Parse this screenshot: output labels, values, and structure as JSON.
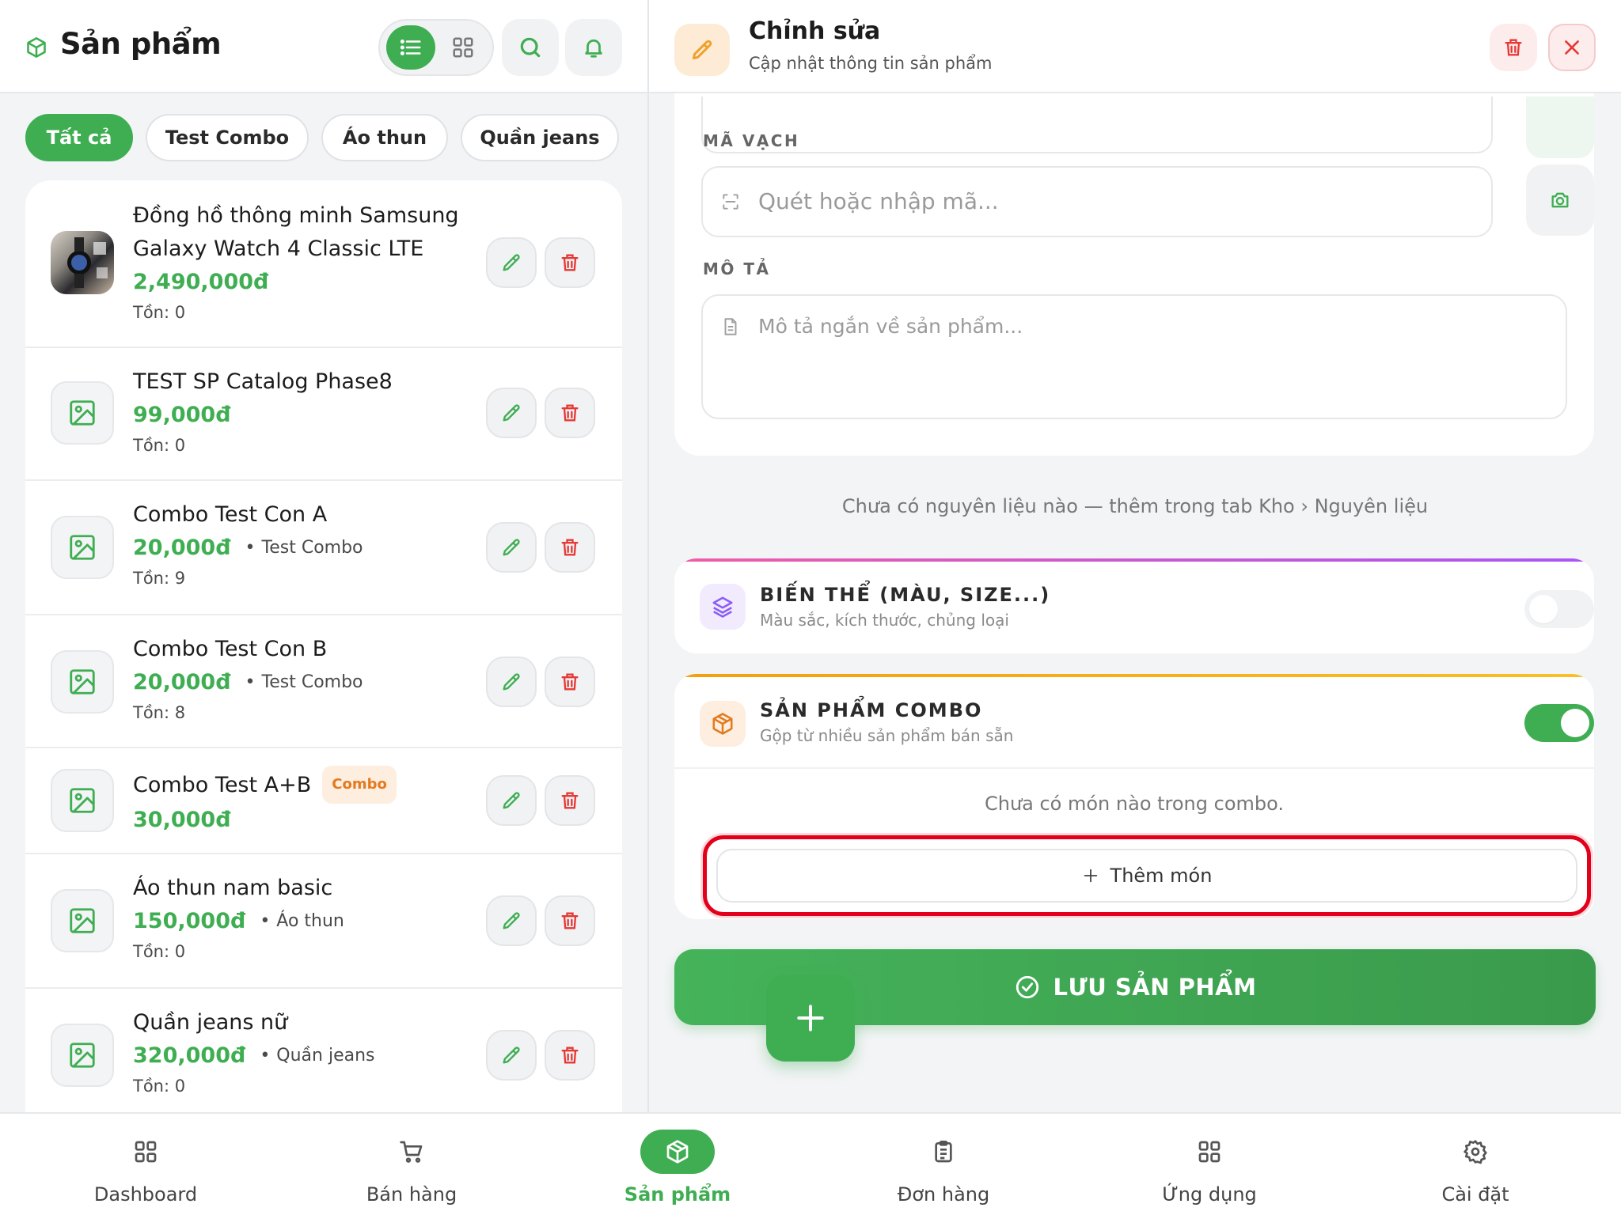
{
  "left_panel": {
    "title": "Sản phẩm",
    "chips": [
      "Tất cả",
      "Test Combo",
      "Áo thun",
      "Quần jeans"
    ],
    "products": [
      {
        "name_line1": "Đồng hồ thông minh Samsung",
        "name_line2": "Galaxy Watch 4 Classic LTE",
        "price": "2,490,000đ",
        "category": "",
        "stock": "Tồn: 0",
        "badge": ""
      },
      {
        "name_line1": "TEST SP Catalog Phase8",
        "name_line2": "",
        "price": "99,000đ",
        "category": "",
        "stock": "Tồn: 0",
        "badge": ""
      },
      {
        "name_line1": "Combo Test Con A",
        "name_line2": "",
        "price": "20,000đ",
        "category": "Test Combo",
        "stock": "Tồn: 9",
        "badge": ""
      },
      {
        "name_line1": "Combo Test Con B",
        "name_line2": "",
        "price": "20,000đ",
        "category": "Test Combo",
        "stock": "Tồn: 8",
        "badge": ""
      },
      {
        "name_line1": "Combo Test A+B",
        "name_line2": "",
        "price": "30,000đ",
        "category": "",
        "stock": "",
        "badge": "Combo"
      },
      {
        "name_line1": "Áo thun nam basic",
        "name_line2": "",
        "price": "150,000đ",
        "category": "Áo thun",
        "stock": "Tồn: 0",
        "badge": ""
      },
      {
        "name_line1": "Quần jeans nữ",
        "name_line2": "",
        "price": "320,000đ",
        "category": "Quần jeans",
        "stock": "Tồn: 0",
        "badge": ""
      }
    ]
  },
  "editor": {
    "title": "Chỉnh sửa",
    "subtitle": "Cập nhật thông tin sản phẩm",
    "barcode_label": "MÃ VẠCH",
    "barcode_placeholder": "Quét hoặc nhập mã...",
    "description_label": "MÔ TẢ",
    "description_placeholder": "Mô tả ngắn về sản phẩm...",
    "ingredients_hint": "Chưa có nguyên liệu nào — thêm trong tab Kho › Nguyên liệu",
    "variants": {
      "title": "BIẾN THỂ (MÀU, SIZE...)",
      "subtitle": "Màu sắc, kích thước, chủng loại",
      "enabled": false
    },
    "combo": {
      "title": "SẢN PHẨM COMBO",
      "subtitle": "Gộp từ nhiều sản phẩm bán sẵn",
      "enabled": true,
      "empty_text": "Chưa có món nào trong combo.",
      "add_label": "Thêm món"
    },
    "save_label": "LƯU SẢN PHẨM"
  },
  "bottom_nav": [
    {
      "label": "Dashboard",
      "icon": "dashboard-icon",
      "active": false
    },
    {
      "label": "Bán hàng",
      "icon": "cart-icon",
      "active": false
    },
    {
      "label": "Sản phẩm",
      "icon": "box-icon",
      "active": true
    },
    {
      "label": "Đơn hàng",
      "icon": "clipboard-icon",
      "active": false
    },
    {
      "label": "Ứng dụng",
      "icon": "apps-icon",
      "active": false
    },
    {
      "label": "Cài đặt",
      "icon": "gear-icon",
      "active": false
    }
  ],
  "colors": {
    "accent": "#3fae52",
    "danger": "#e53935",
    "combo_orange": "#e37a1f",
    "variant_purple": "#8b5cf6",
    "highlight": "#e2001a"
  }
}
